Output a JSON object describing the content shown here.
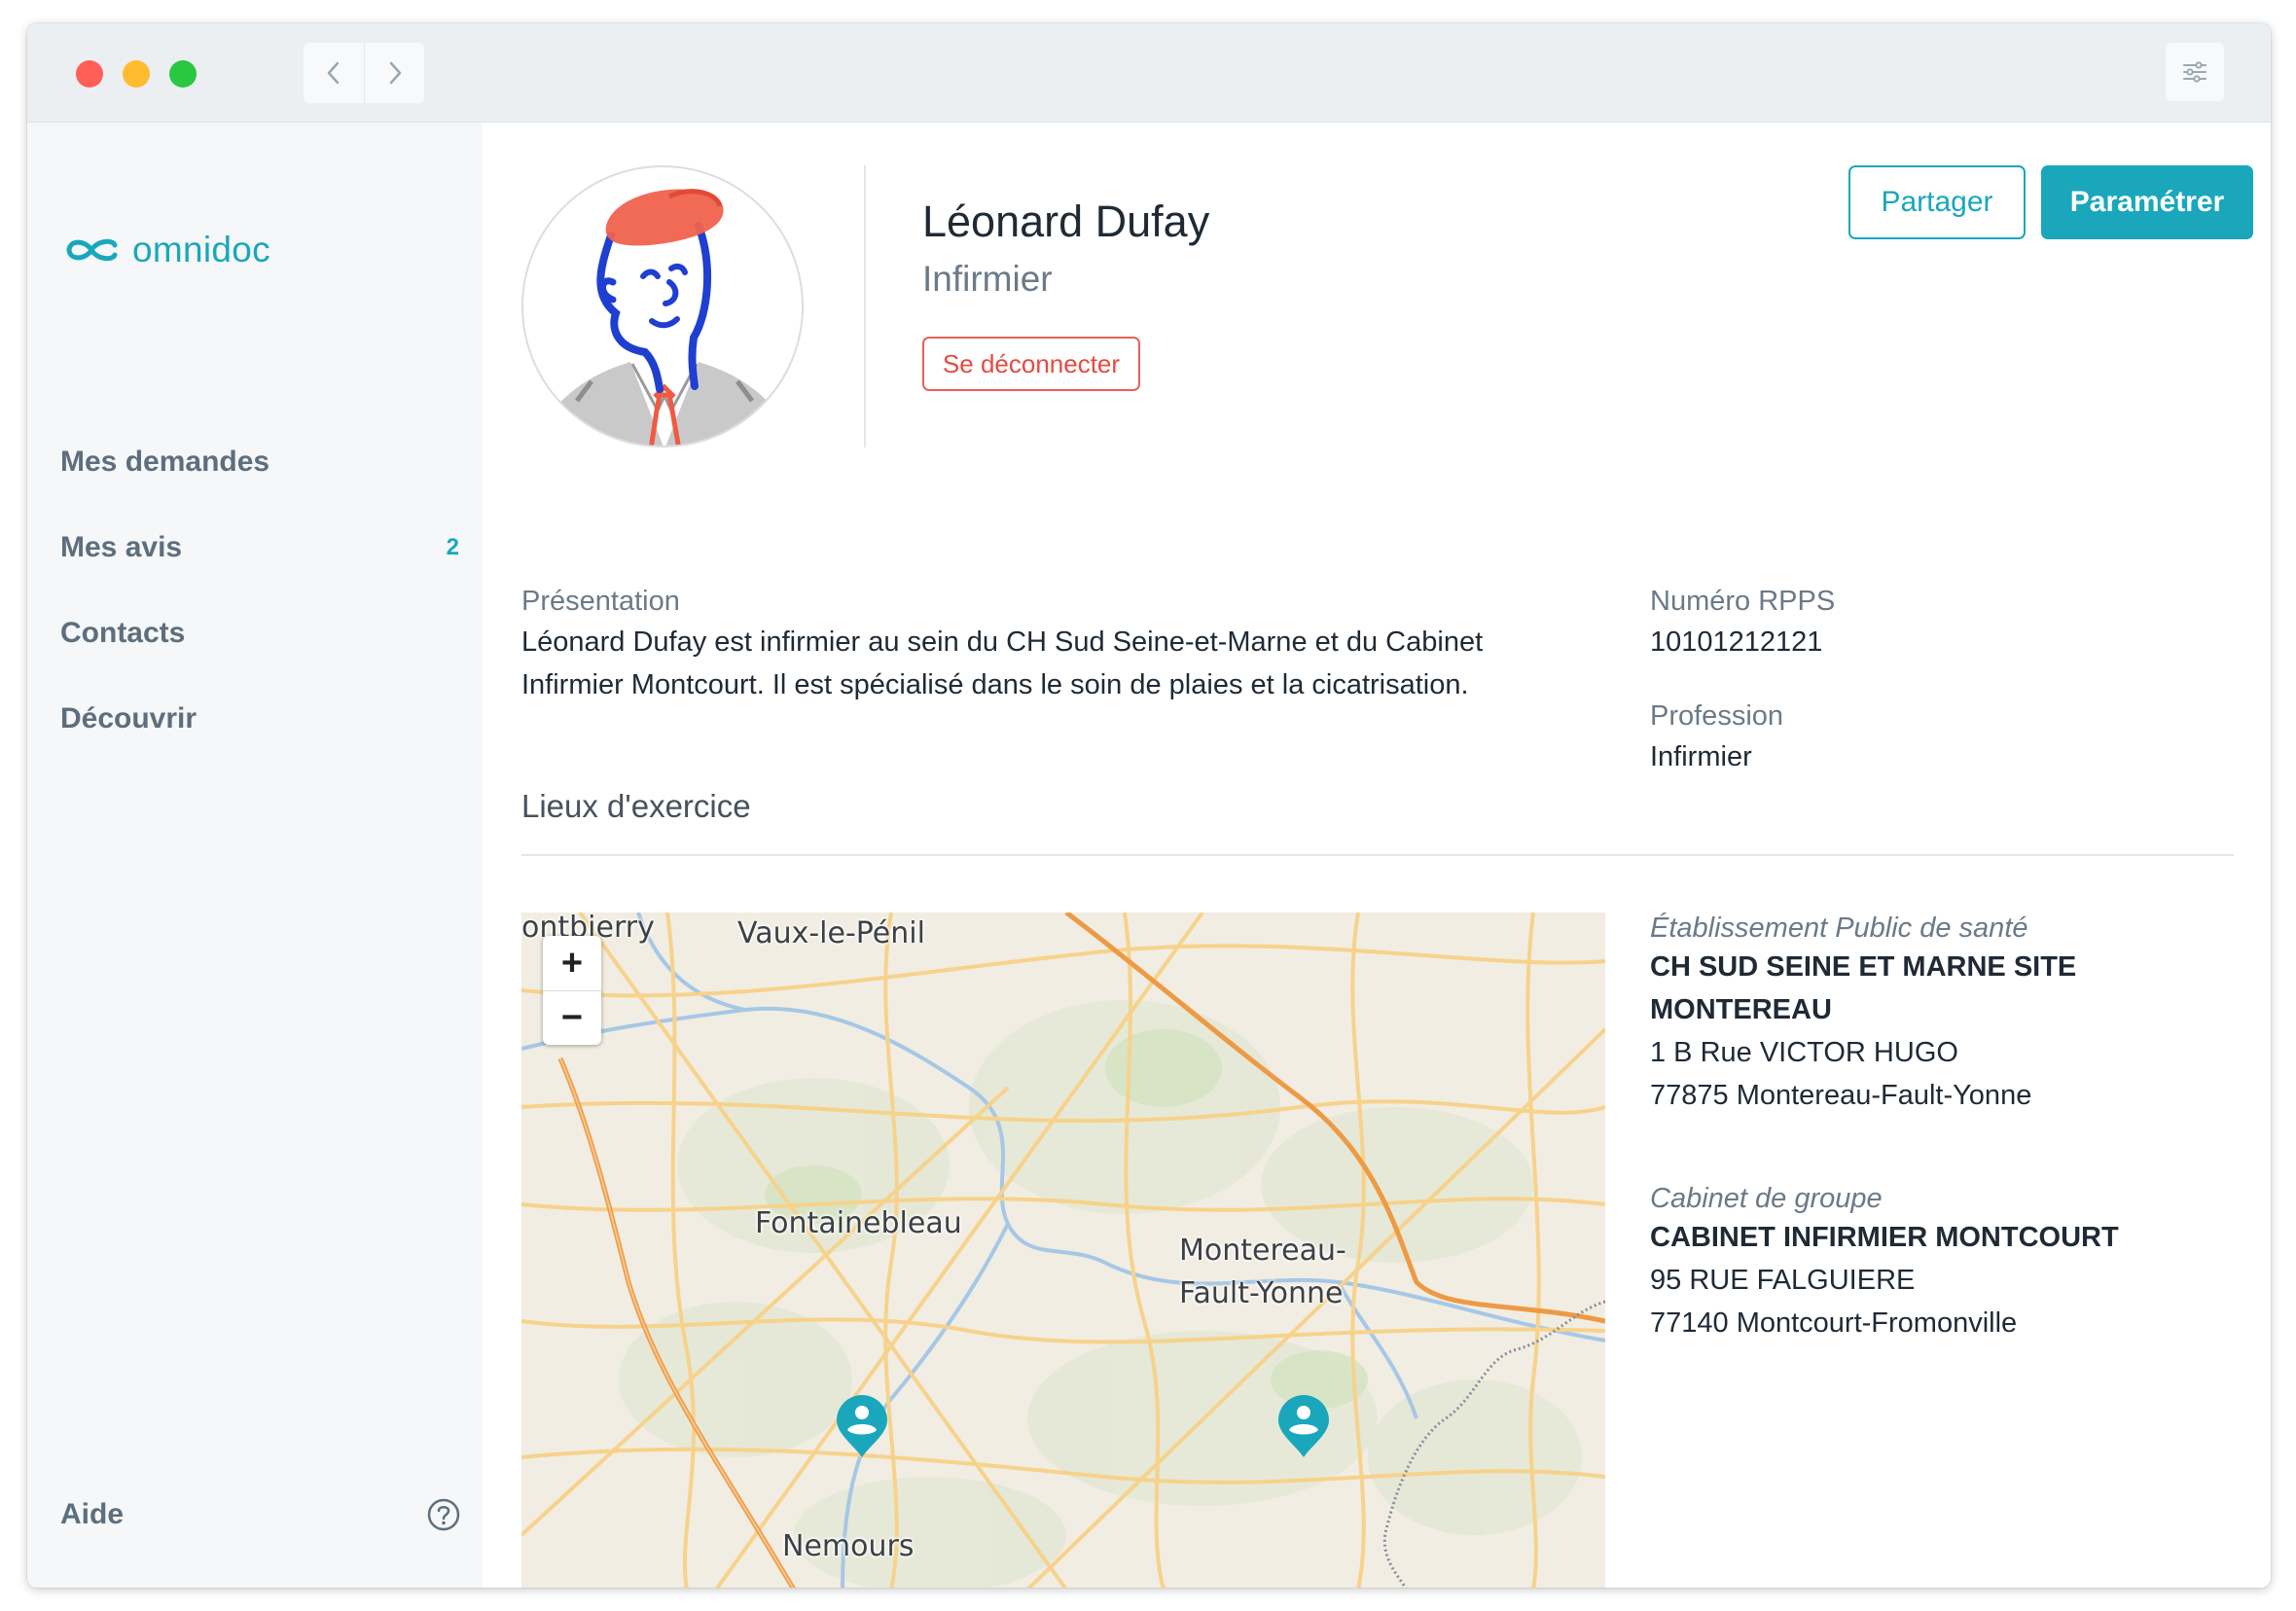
{
  "window": {
    "nav": {
      "back_icon": "chevron-left-icon",
      "forward_icon": "chevron-right-icon"
    },
    "settings_icon": "sliders-icon"
  },
  "sidebar": {
    "logo_text": "omnidoc",
    "items": [
      {
        "label": "Mes demandes",
        "badge": ""
      },
      {
        "label": "Mes avis",
        "badge": "2"
      },
      {
        "label": "Contacts",
        "badge": ""
      },
      {
        "label": "Découvrir",
        "badge": ""
      }
    ],
    "help_label": "Aide",
    "help_icon": "question-circle-icon"
  },
  "profile": {
    "name": "Léonard Dufay",
    "role": "Infirmier",
    "logout_label": "Se déconnecter",
    "share_label": "Partager",
    "config_label": "Paramétrer"
  },
  "presentation": {
    "label": "Présentation",
    "line1": "Léonard Dufay est infirmier au sein du CH Sud Seine-et-Marne et du Cabinet",
    "line2": "Infirmier Montcourt. Il est spécialisé dans le soin de plaies et la cicatrisation."
  },
  "rpps": {
    "label": "Numéro RPPS",
    "value": "10101212121"
  },
  "profession": {
    "label": "Profession",
    "value": "Infirmier"
  },
  "places": {
    "section_title": "Lieux d'exercice",
    "map": {
      "labels": [
        "ontbierry",
        "Vaux-le-Pénil",
        "Fontainebleau",
        "Montereau-",
        "Fault-Yonne",
        "Nemours"
      ],
      "zoom_in": "+",
      "zoom_out": "−"
    },
    "list": [
      {
        "type": "Établissement Public de santé",
        "name_line1": "CH SUD SEINE ET MARNE SITE",
        "name_line2": "MONTEREAU",
        "address": "1 B Rue VICTOR HUGO",
        "city": "77875 Montereau-Fault-Yonne"
      },
      {
        "type": "Cabinet de groupe",
        "name_line1": "CABINET INFIRMIER MONTCOURT",
        "address": "95 RUE FALGUIERE",
        "city": "77140 Montcourt-Fromonville"
      }
    ]
  },
  "colors": {
    "accent": "#1aa7bc",
    "danger": "#e44a42",
    "sidebar_bg": "#f5f7f8"
  }
}
